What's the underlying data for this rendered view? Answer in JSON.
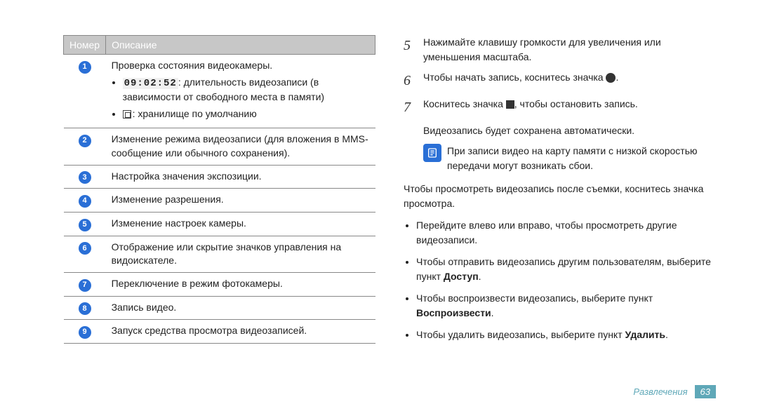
{
  "table": {
    "header_num": "Номер",
    "header_desc": "Описание",
    "row1_title": "Проверка состояния видеокамеры.",
    "row1_bullet1_time": "09:02:52",
    "row1_bullet1_text": ": длительность видеозаписи (в зависимости от свободного места в памяти)",
    "row1_bullet2": ": хранилище по умолчанию",
    "row2": "Изменение режима видеозаписи (для вложения в MMS-сообщение или обычного сохранения).",
    "row3": "Настройка значения экспозиции.",
    "row4": "Изменение разрешения.",
    "row5": "Изменение настроек камеры.",
    "row6": "Отображение или скрытие значков управления на видоискателе.",
    "row7": "Переключение в режим фотокамеры.",
    "row8": "Запись видео.",
    "row9": "Запуск средства просмотра видеозаписей."
  },
  "steps": {
    "s5_num": "5",
    "s5": "Нажимайте клавишу громкости для увеличения или уменьшения масштаба.",
    "s6_num": "6",
    "s6_a": "Чтобы начать запись, коснитесь значка ",
    "s6_b": ".",
    "s7_num": "7",
    "s7_a": "Коснитесь значка ",
    "s7_b": ", чтобы остановить запись.",
    "s7_sub": "Видеозапись будет сохранена автоматически."
  },
  "note": "При записи видео на карту памяти с низкой скоростью передачи могут возникать сбои.",
  "after_note": "Чтобы просмотреть видеозапись после съемки, коснитесь значка просмотра.",
  "bullets": {
    "b1": "Перейдите влево или вправо, чтобы просмотреть другие видеозаписи.",
    "b2_a": "Чтобы отправить видеозапись другим пользователям, выберите пункт ",
    "b2_b": "Доступ",
    "b2_c": ".",
    "b3_a": "Чтобы воспроизвести видеозапись, выберите пункт ",
    "b3_b": "Воспроизвести",
    "b3_c": ".",
    "b4_a": "Чтобы удалить видеозапись, выберите пункт ",
    "b4_b": "Удалить",
    "b4_c": "."
  },
  "footer": {
    "category": "Развлечения",
    "page": "63"
  },
  "nums": {
    "n1": "1",
    "n2": "2",
    "n3": "3",
    "n4": "4",
    "n5": "5",
    "n6": "6",
    "n7": "7",
    "n8": "8",
    "n9": "9"
  }
}
